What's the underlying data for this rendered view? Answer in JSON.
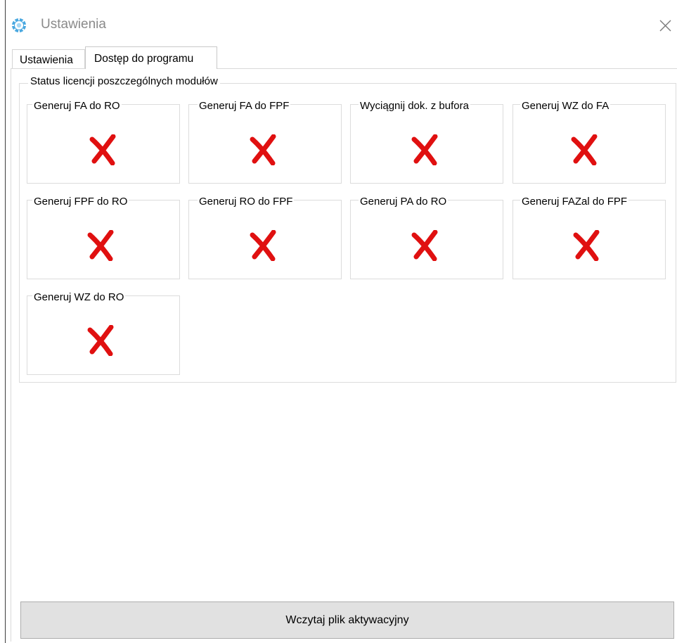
{
  "window": {
    "title": "Ustawienia",
    "icon": "gear-icon",
    "close_icon": "close-icon"
  },
  "tabs": [
    {
      "label": "Ustawienia",
      "active": false
    },
    {
      "label": "Dostęp do programu",
      "active": true
    }
  ],
  "license_group": {
    "title": "Status licencji poszczególnych modułów",
    "status_color": "#e01010",
    "modules": [
      {
        "label": "Generuj FA do RO",
        "status": "x-icon"
      },
      {
        "label": "Generuj FA do FPF",
        "status": "x-icon"
      },
      {
        "label": "Wyciągnij dok. z bufora",
        "status": "x-icon"
      },
      {
        "label": "Generuj WZ do FA",
        "status": "x-icon"
      },
      {
        "label": "Generuj FPF do RO",
        "status": "x-icon"
      },
      {
        "label": "Generuj RO do FPF",
        "status": "x-icon"
      },
      {
        "label": "Generuj PA do RO",
        "status": "x-icon"
      },
      {
        "label": "Generuj FAZal do FPF",
        "status": "x-icon"
      },
      {
        "label": "Generuj WZ do RO",
        "status": "x-icon"
      }
    ]
  },
  "buttons": {
    "load_activation_file": "Wczytaj plik aktywacyjny"
  }
}
